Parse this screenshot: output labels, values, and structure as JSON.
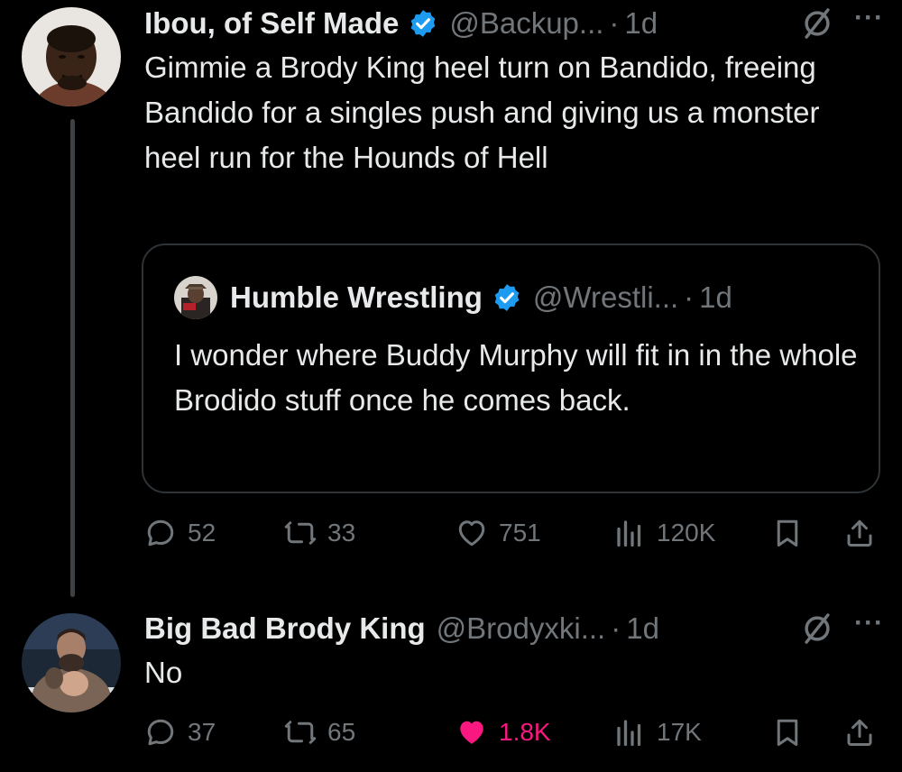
{
  "tweets": [
    {
      "author_name": "Ibou, of Self Made",
      "handle": "@Backup...",
      "separator": "·",
      "time": "1d",
      "verified": true,
      "more": "···",
      "text": "Gimmie a Brody King heel turn on Bandido, freeing Bandido for a singles push and giving us a monster heel run for the Hounds of Hell",
      "quote": {
        "author_name": "Humble Wrestling",
        "handle": "@Wrestli...",
        "separator": "·",
        "time": "1d",
        "verified": true,
        "text": "I wonder where Buddy Murphy will fit in in the whole Brodido stuff once he comes back."
      },
      "stats": {
        "replies": "52",
        "reposts": "33",
        "likes": "751",
        "views": "120K"
      },
      "liked": false
    },
    {
      "author_name": "Big Bad Brody King",
      "handle": "@Brodyxki...",
      "separator": "·",
      "time": "1d",
      "verified": false,
      "more": "···",
      "text": "No",
      "stats": {
        "replies": "37",
        "reposts": "65",
        "likes": "1.8K",
        "views": "17K"
      },
      "liked": true
    }
  ],
  "colors": {
    "background": "#000000",
    "text": "#e7e9ea",
    "secondary": "#71767b",
    "verified_blue": "#1d9bf0",
    "like_pink": "#f91880",
    "border": "#2f3336"
  }
}
